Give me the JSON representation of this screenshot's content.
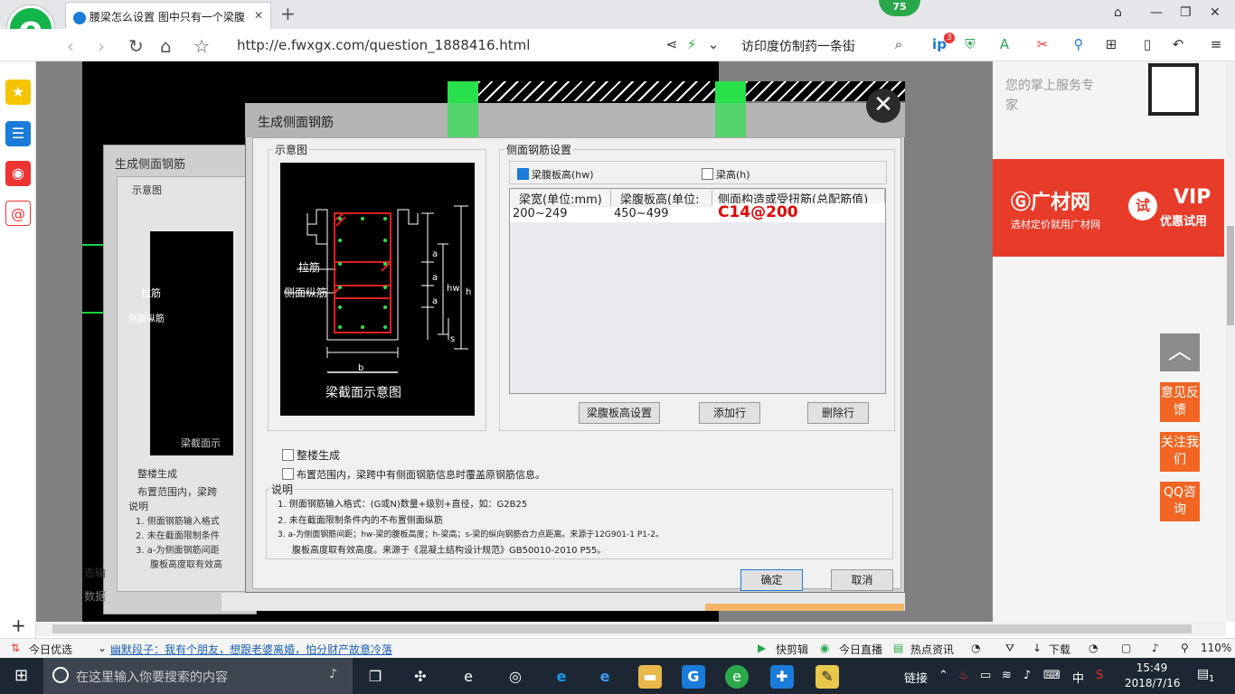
{
  "browser": {
    "tab_title": "腰梁怎么设置 图中只有一个梁腹",
    "url_prefix": "http://e.",
    "url_domain": "fwxgx.com",
    "url_path": "/question_1888416.html",
    "search_text": "访印度仿制药一条街",
    "badge_count": "75",
    "notification_count": "3"
  },
  "right_panel": {
    "text_line1": "您的掌上服务专",
    "text_line2": "家",
    "ad_brand": "广材网",
    "ad_sub": "选材定价就用广材网",
    "ad_try": "试",
    "ad_vip": "VIP",
    "ad_vip_sub": "优惠试用",
    "feedback": "意见反馈",
    "follow": "关注我们",
    "qq": "QQ咨询"
  },
  "status_bar": {
    "today": "今日优选",
    "headline": "幽默段子：我有个朋友，想跟老婆离婚，怕分财产故意冷落",
    "quick_cut": "快剪辑",
    "live": "今日直播",
    "news": "热点资讯",
    "download": "下载",
    "zoom": "110%"
  },
  "taskbar": {
    "search_placeholder": "在这里输入你要搜索的内容",
    "tray_link": "链接",
    "ime": "中",
    "time": "15:49",
    "date": "2018/7/16",
    "notifications": "1"
  },
  "ghost_dialog": {
    "title": "生成侧面钢筋",
    "diagram_group": "示意图",
    "tie_bar": "拉筋",
    "side_rebar": "侧面纵筋",
    "section_caption": "梁截面示",
    "whole_building": "整楼生成",
    "in_range": "布置范围内，梁跨",
    "explain": "说明",
    "line1": "1. 侧面钢筋输入格式",
    "line2": "2. 未在截面限制条件",
    "line3": "3. a-为侧面钢筋间距",
    "line4": "腹板高度取有效高",
    "status_input": "态输",
    "data_label": "数据"
  },
  "dialog": {
    "title": "生成侧面钢筋",
    "diagram_group": "示意图",
    "diagram": {
      "tie_bar": "拉筋",
      "side_rebar": "侧面纵筋",
      "dim_a": "a",
      "dim_hw": "hw",
      "dim_h": "h",
      "dim_s": "s",
      "dim_b": "b",
      "caption": "梁截面示意图"
    },
    "settings_group": "侧面钢筋设置",
    "radio_web_height": "梁腹板高(hw)",
    "radio_beam_height": "梁高(h)",
    "table": {
      "headers": [
        "梁宽(单位:mm)",
        "梁腹板高(单位:",
        "侧面构造或受扭筋(总配筋值)"
      ],
      "rows": [
        [
          "200~249",
          "450~499",
          "C14@200"
        ]
      ]
    },
    "btn_web_height": "梁腹板高设置",
    "btn_add_row": "添加行",
    "btn_delete_row": "删除行",
    "chk_whole_building": "整楼生成",
    "chk_override": "布置范围内，梁跨中有侧面钢筋信息时覆盖原钢筋信息。",
    "explain_title": "说明",
    "explain_lines": [
      "1. 侧面钢筋输入格式：(G或N)数量+级别+直径，如：G2B25",
      "2. 未在截面限制条件内的不布置侧面纵筋",
      "3. a-为侧面钢筋间距；hw-梁的腹板高度；h-梁高；s-梁的纵向钢筋合力点距离。来源于12G901-1 P1-2。",
      "腹板高度取有效高度。来源于《混凝土结构设计规范》GB50010-2010 P55。"
    ],
    "ok": "确定",
    "cancel": "取消"
  }
}
